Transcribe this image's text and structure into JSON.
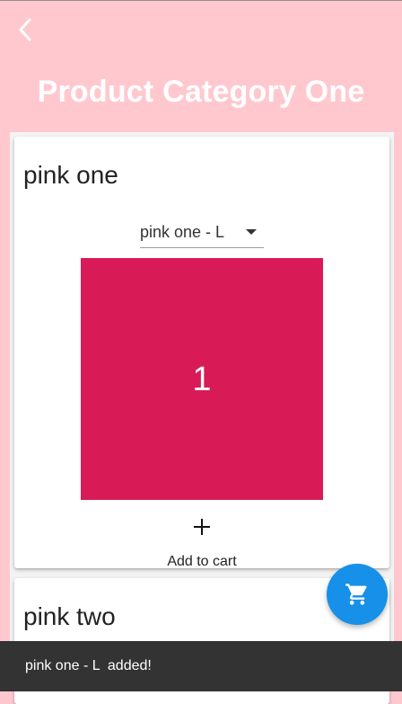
{
  "header": {
    "back_icon": "chevron-left-icon",
    "title": "Product Category One"
  },
  "products": [
    {
      "name": "pink one",
      "selected_variant": "pink one - L",
      "image_label": "1",
      "image_color": "#d81b57",
      "add_icon": "plus-icon",
      "add_label": "Add to cart"
    },
    {
      "name": "pink two"
    }
  ],
  "fab": {
    "icon": "shopping-cart-icon",
    "color": "#1690e8"
  },
  "snackbar": {
    "message": "pink one - L  added!"
  },
  "colors": {
    "background": "#ffc8cf",
    "title": "#ffffff",
    "snackbar": "#333333"
  }
}
